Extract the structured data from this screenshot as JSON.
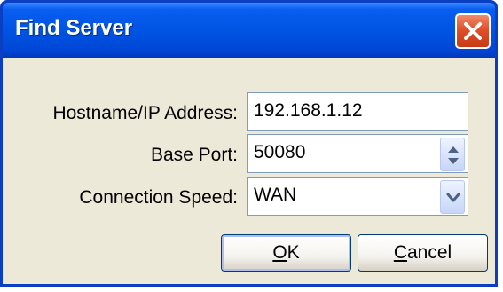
{
  "window": {
    "title": "Find Server"
  },
  "form": {
    "hostname": {
      "label": "Hostname/IP Address:",
      "value": "192.168.1.12"
    },
    "base_port": {
      "label": "Base Port:",
      "value": "50080"
    },
    "connection_speed": {
      "label": "Connection Speed:",
      "value": "WAN"
    }
  },
  "buttons": {
    "ok": {
      "mnemonic": "O",
      "rest": "K"
    },
    "cancel": {
      "mnemonic": "C",
      "rest": "ancel"
    }
  },
  "icons": {
    "close": "close-icon",
    "spin_up": "arrow-up-icon",
    "spin_down": "arrow-down-icon",
    "dropdown": "chevron-down-icon"
  },
  "colors": {
    "titlebar": "#0054e3",
    "client": "#ece9d8",
    "close_button": "#e0502a",
    "field_border": "#7f9db9"
  }
}
